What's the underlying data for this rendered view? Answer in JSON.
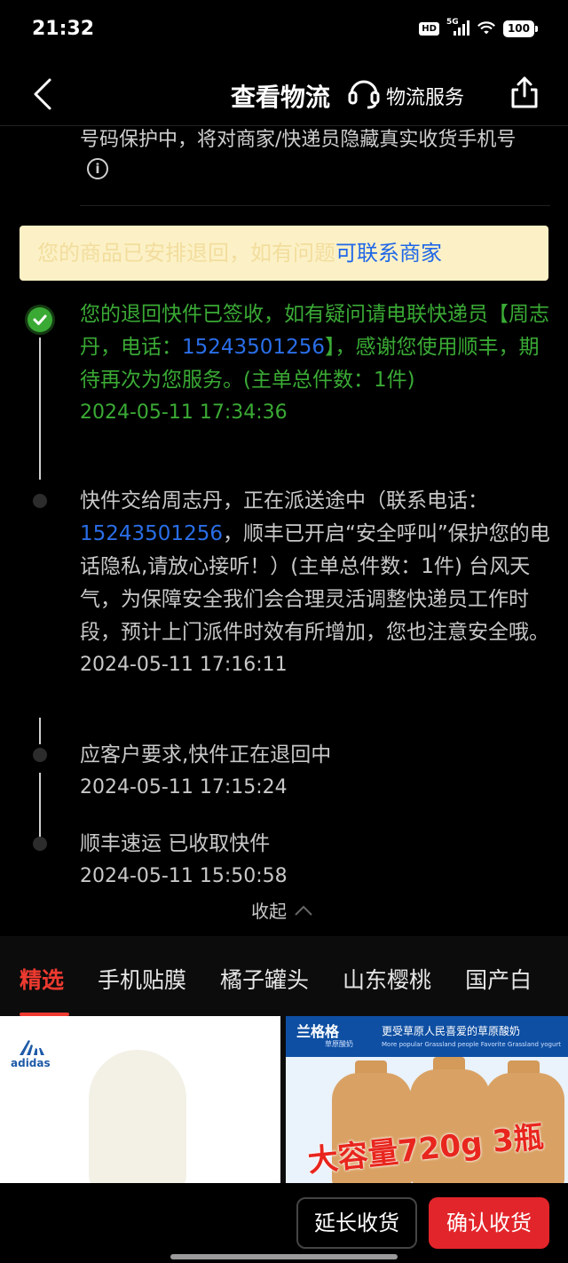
{
  "status_bar": {
    "time": "21:32",
    "hd": "HD",
    "network": "5G",
    "battery": "100"
  },
  "nav": {
    "title": "查看物流",
    "service_label": "物流服务",
    "icons": [
      "back-icon",
      "headset-icon",
      "share-icon"
    ]
  },
  "notice": {
    "privacy": "号码保护中，将对商家/快递员隐藏真实收货手机号",
    "banner_text": "您的商品已安排退回，如有问题",
    "banner_link": "可联系商家"
  },
  "timeline": [
    {
      "text_before": "您的退回快件已签收，如有疑问请电联快递员【周志丹，电话：",
      "phone": "15243501256",
      "text_after": "】，感谢您使用顺丰，期待再次为您服务。(主单总件数：1件)",
      "time": "2024-05-11 17:34:36",
      "status": "delivered"
    },
    {
      "text_before": "快件交给周志丹，正在派送途中（联系电话：",
      "phone": "15243501256",
      "text_after": "，顺丰已开启“安全呼叫”保护您的电话隐私,请放心接听！）(主单总件数：1件) 台风天气，为保障安全我们会合理灵活调整快递员工作时段，预计上门派件时效有所增加，您也注意安全哦。",
      "time": "2024-05-11 17:16:11"
    },
    {
      "text": "应客户要求,快件正在退回中",
      "time": "2024-05-11 17:15:24"
    },
    {
      "text": "顺丰速运 已收取快件",
      "time": "2024-05-11 15:50:58"
    }
  ],
  "collapse_label": "收起",
  "category_tabs": [
    "精选",
    "手机贴膜",
    "橘子罐头",
    "山东樱桃",
    "国产白"
  ],
  "products": {
    "card1": {
      "brand": "adidas"
    },
    "card2": {
      "brand": "兰格格",
      "brand_sub": "草原酸奶",
      "slogan": "更受草原人民喜爱的草原酸奶",
      "slogan_en": "More popular Grassland people Favorite Grassland yogurt",
      "promo": "大容量720g 3瓶"
    }
  },
  "bottom": {
    "extend_label": "延长收货",
    "confirm_label": "确认收货"
  },
  "colors": {
    "accent_red": "#e2252a",
    "success_green": "#3aaa35",
    "link_blue": "#1f67e8",
    "banner_bg": "#fcf1c6"
  }
}
